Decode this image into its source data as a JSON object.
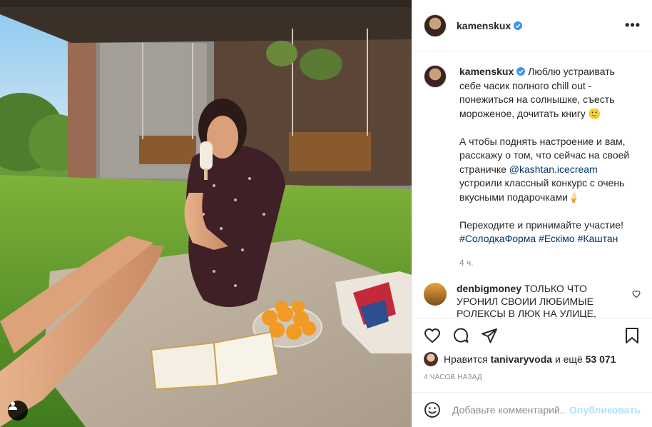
{
  "post": {
    "username": "kamenskux",
    "caption": {
      "intro": "Люблю устраивать себе часик полного chill out - понежиться на солнышке, съесть мороженое, дочитать книгу 🙂",
      "para2_before": "А чтобы поднять настроение и вам, расскажу о том, что сейчас на своей страничке",
      "mention": "@kashtan.icecream",
      "para2_after": "устроили классный конкурс с очень вкусными подарочками🍦",
      "para3": "Переходите и принимайте участие!",
      "hashtags": [
        "#СолодкаФорма",
        "#Ескімо",
        "#Каштан"
      ]
    },
    "caption_time": "4 ч.",
    "comments": [
      {
        "username": "denbigmoney",
        "text": "ТОЛЬКО ЧТО УРОНИЛ СВОИИ ЛЮБИМЫЕ РОЛЕКСЫ В ЛЮК НА УЛИЦЕ,"
      }
    ],
    "likes": {
      "prefix": "Нравится",
      "user": "tanivaryvoda",
      "suffix": "и ещё",
      "count": "53 071"
    },
    "timestamp": "4 ЧАСОВ НАЗАД",
    "add_comment": {
      "placeholder": "Добавьте комментарий...",
      "publish_label": "Опубликовать"
    },
    "icons": {
      "more": "more-options-icon",
      "like": "heart-icon",
      "comment": "comment-icon",
      "share": "share-icon",
      "save": "bookmark-icon",
      "emoji": "emoji-icon",
      "tag": "user-tag-icon",
      "verified": "verified-badge-icon"
    },
    "colors": {
      "link": "#00376b",
      "verified": "#3897f0",
      "publish_disabled": "#b2dffc",
      "muted": "#8e8e8e"
    }
  }
}
